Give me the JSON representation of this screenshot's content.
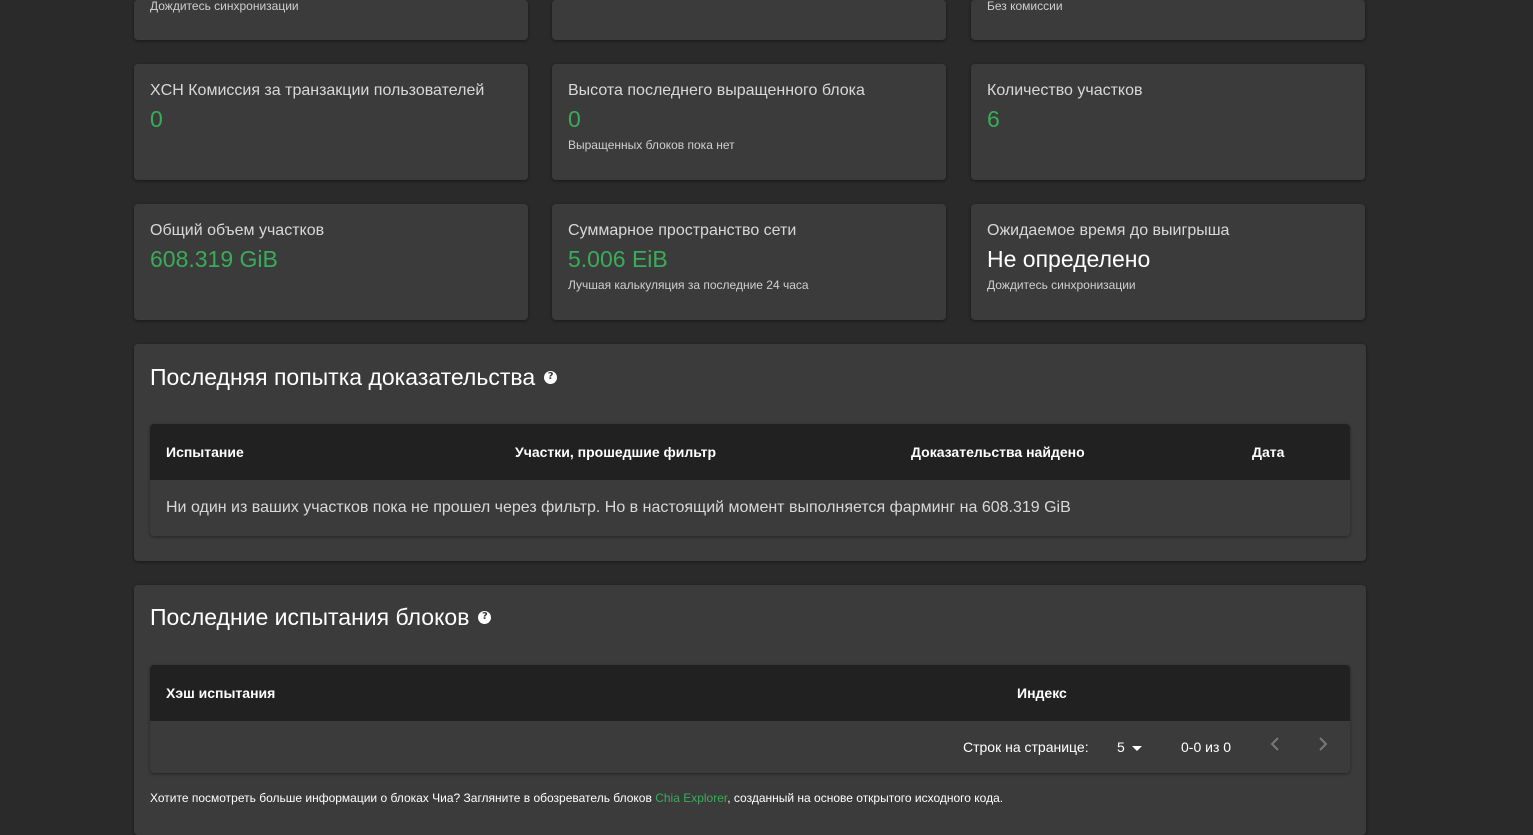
{
  "top_partial": {
    "left_sub": "Дождитесь синхронизации",
    "right_sub": "Без комиссии"
  },
  "stats_row1": [
    {
      "title": "XCH Комиссия за транзакции пользователей",
      "value": "0",
      "sub": ""
    },
    {
      "title": "Высота последнего выращенного блока",
      "value": "0",
      "sub": "Выращенных блоков пока нет"
    },
    {
      "title": "Количество участков",
      "value": "6",
      "sub": ""
    }
  ],
  "stats_row2": [
    {
      "title": "Общий объем участков",
      "value": "608.319 GiB",
      "sub": ""
    },
    {
      "title": "Суммарное пространство сети",
      "value": "5.006 EiB",
      "sub": "Лучшая калькуляция за последние 24 часа"
    },
    {
      "title": "Ожидаемое время до выигрыша",
      "value": "Не определено",
      "sub": "Дождитесь синхронизации"
    }
  ],
  "proofs": {
    "title": "Последняя попытка доказательства",
    "columns": [
      "Испытание",
      "Участки, прошедшие фильтр",
      "Доказательства найдено",
      "Дата"
    ],
    "empty_message": "Ни один из ваших участков пока не прошел через фильтр. Но в настоящий момент выполняется фарминг на 608.319 GiB"
  },
  "challenges": {
    "title": "Последние испытания блоков",
    "columns": [
      "Хэш испытания",
      "Индекс"
    ],
    "pager": {
      "rows_label": "Строк на странице:",
      "rows_value": "5",
      "range": "0-0 из 0"
    },
    "footnote_before": "Хотите посмотреть больше информации о блоках Чиа? Загляните в обозреватель блоков ",
    "footnote_link": "Chia Explorer",
    "footnote_after": ", созданный на основе открытого исходного кода."
  },
  "colors": {
    "accent_green": "#3aac59",
    "card_bg": "#3b3b3b",
    "page_bg": "#2a2a2a",
    "table_head_bg": "#212121"
  },
  "icons": {
    "help": "question-mark-circle",
    "prev": "chevron-left",
    "next": "chevron-right",
    "dropdown": "caret-down"
  }
}
